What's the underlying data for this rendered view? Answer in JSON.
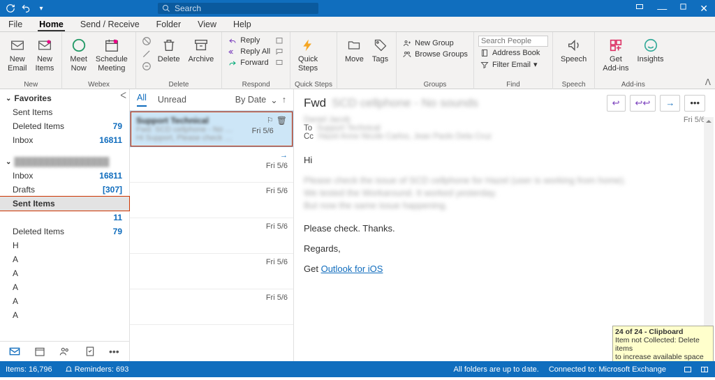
{
  "titlebar": {
    "search_placeholder": "Search"
  },
  "menutabs": [
    "File",
    "Home",
    "Send / Receive",
    "Folder",
    "View",
    "Help"
  ],
  "ribbon": {
    "new": {
      "label": "New",
      "new_email": "New\nEmail",
      "new_items": "New\nItems"
    },
    "webex": {
      "label": "Webex",
      "meet_now": "Meet\nNow",
      "schedule": "Schedule\nMeeting"
    },
    "delete": {
      "label": "Delete",
      "delete": "Delete",
      "archive": "Archive"
    },
    "respond": {
      "label": "Respond",
      "reply": "Reply",
      "reply_all": "Reply All",
      "forward": "Forward"
    },
    "quicksteps": {
      "label": "Quick Steps",
      "quick": "Quick\nSteps"
    },
    "move": {
      "label": "Move",
      "move": "Move",
      "tags": "Tags"
    },
    "groups": {
      "label": "Groups",
      "new_group": "New Group",
      "browse": "Browse Groups"
    },
    "find": {
      "label": "Find",
      "search_people_placeholder": "Search People",
      "address": "Address Book",
      "filter": "Filter Email"
    },
    "speech": {
      "label": "Speech",
      "speech": "Speech"
    },
    "addins": {
      "label": "Add-ins",
      "get": "Get\nAdd-ins",
      "insights": "Insights"
    }
  },
  "folders": {
    "favorites_label": "Favorites",
    "favorites": [
      {
        "name": "Sent Items",
        "count": ""
      },
      {
        "name": "Deleted Items",
        "count": "79"
      },
      {
        "name": "Inbox",
        "count": "16811"
      }
    ],
    "account_label": "████████████████",
    "items": [
      {
        "name": "Inbox",
        "count": "16811"
      },
      {
        "name": "Drafts",
        "count": "[307]"
      },
      {
        "name": "Sent Items",
        "count": "",
        "selected": true,
        "boxed": true
      },
      {
        "name": "",
        "count": "11"
      },
      {
        "name": "Deleted Items",
        "count": "79"
      },
      {
        "name": "H",
        "count": ""
      },
      {
        "name": "A",
        "count": ""
      },
      {
        "name": "A",
        "count": ""
      },
      {
        "name": "A",
        "count": ""
      },
      {
        "name": "A",
        "count": ""
      },
      {
        "name": "A",
        "count": ""
      }
    ]
  },
  "msglist": {
    "tabs": {
      "all": "All",
      "unread": "Unread"
    },
    "sort": "By Date",
    "items": [
      {
        "subj": "Support Technical",
        "preview": "Fwd: SCD cellphone - No sound...",
        "preview2": "Hi Support, Please check the...",
        "date": "Fri 5/6",
        "selected": true
      },
      {
        "subj": "",
        "preview": "",
        "date": "Fri 5/6",
        "forwarded": true
      },
      {
        "subj": "",
        "preview": "",
        "date": "Fri 5/6"
      },
      {
        "subj": "",
        "preview": "",
        "date": "Fri 5/6"
      },
      {
        "subj": "",
        "preview": "",
        "date": "Fri 5/6"
      },
      {
        "subj": "",
        "preview": "",
        "date": "Fri 5/6"
      }
    ]
  },
  "reading": {
    "subject_prefix": "Fwd",
    "subject_blur": "SCD cellphone - No sounds",
    "from_blur": "Daniel Jacob",
    "to_label": "To",
    "to_blur": "Support Technical",
    "cc_label": "Cc",
    "cc_blur": "Hazel Anne Nicole Carlos, Jean Paolo Dela Cruz",
    "date": "Fri 5/6",
    "body": {
      "hi": "Hi",
      "blur1": "Please check the issue of SCD cellphone for Hazel (user is working from home).",
      "blur2": "We tested the Workaround. It worked yesterday.",
      "blur3": "But now the same issue happening.",
      "check": "Please check. Thanks.",
      "regards": "Regards,",
      "get": "Get ",
      "outlook_link": "Outlook for iOS"
    }
  },
  "clipboard": {
    "title": "24 of 24 - Clipboard",
    "line1": "Item not Collected: Delete items",
    "line2": "to increase available space"
  },
  "statusbar": {
    "items": "Items: 16,796",
    "reminders": "Reminders: 693",
    "uptodate": "All folders are up to date.",
    "connected": "Connected to: Microsoft Exchange"
  }
}
